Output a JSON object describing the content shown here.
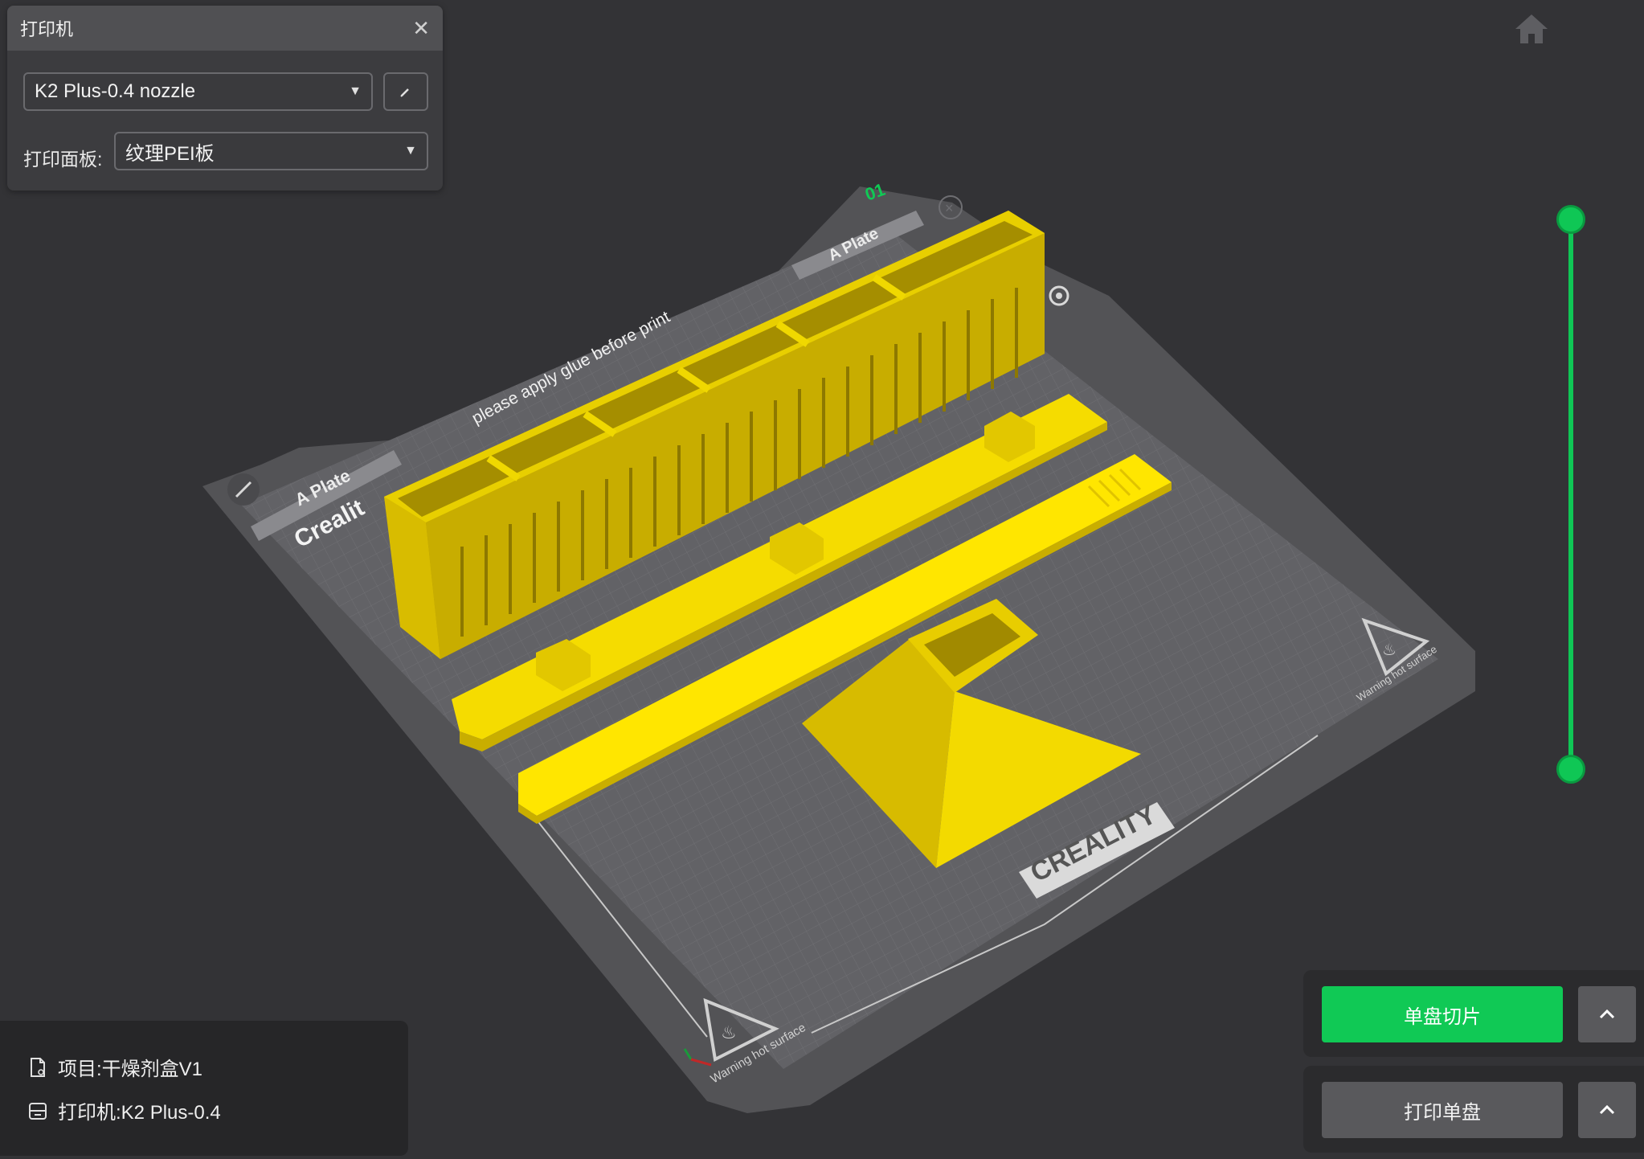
{
  "printer_panel": {
    "title": "打印机",
    "printer": "K2 Plus-0.4 nozzle",
    "bed_label": "打印面板:",
    "bed_type": "纹理PEI板"
  },
  "plate": {
    "number": "01",
    "name_top": "A Plate",
    "name_left": "A Plate",
    "notice": "please apply glue before print",
    "brand_partial": "Crealit",
    "brand_logo": "CREALITY",
    "warning_right": "Warning hot surface",
    "warning_bottom": "Warning hot surface"
  },
  "project_info": {
    "project": "项目:干燥剂盒V1",
    "printer": "打印机:K2 Plus-0.4"
  },
  "actions": {
    "slice": "单盘切片",
    "print": "打印单盘"
  },
  "colors": {
    "accent": "#10c955",
    "model": "#f5dc00",
    "background": "#333336"
  },
  "icons": {
    "close": "close-icon",
    "edit": "pencil-icon",
    "home": "home-icon",
    "expand": "chevron-up-icon",
    "project": "file-icon",
    "printer": "printer-icon"
  }
}
